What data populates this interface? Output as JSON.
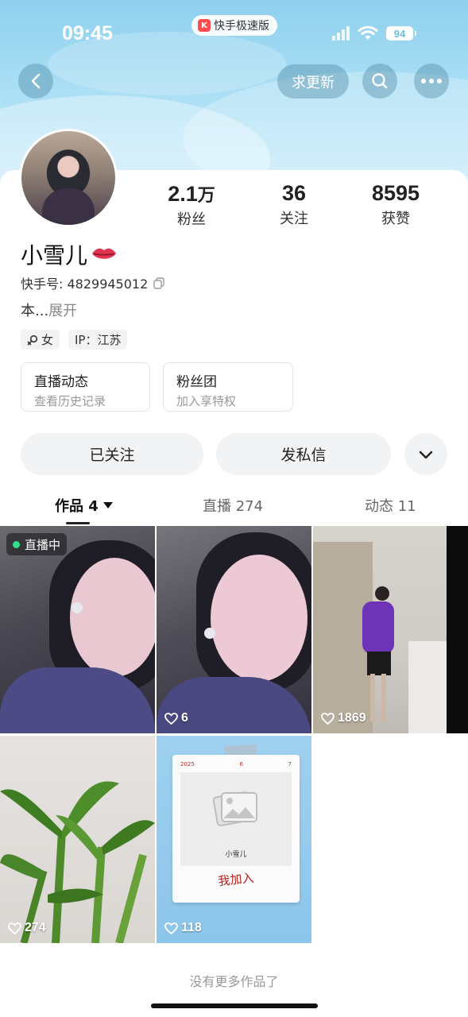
{
  "status_bar": {
    "time": "09:45",
    "app_badge": "快手极速版",
    "battery": "94"
  },
  "header": {
    "update_label": "求更新"
  },
  "profile": {
    "stats": [
      {
        "value": "2.1",
        "unit": "万",
        "label": "粉丝"
      },
      {
        "value": "36",
        "unit": "",
        "label": "关注"
      },
      {
        "value": "8595",
        "unit": "",
        "label": "获赞"
      }
    ],
    "name": "小雪儿",
    "kuaishou_id": "快手号: 4829945012",
    "bio": "本...",
    "bio_more": "展开",
    "gender_tag": "女",
    "ip_tag": "IP：江苏"
  },
  "info_boxes": [
    {
      "title": "直播动态",
      "subtitle": "查看历史记录"
    },
    {
      "title": "粉丝团",
      "subtitle": "加入享特权"
    }
  ],
  "actions": {
    "followed": "已关注",
    "message": "发私信"
  },
  "tabs": [
    {
      "label": "作品 4"
    },
    {
      "label": "直播 274"
    },
    {
      "label": "动态 11"
    }
  ],
  "posts": [
    {
      "badge": "直播中",
      "likes": ""
    },
    {
      "likes": "6"
    },
    {
      "likes": "1869"
    },
    {
      "likes": "274"
    },
    {
      "likes": "118",
      "card_date_left": "2025",
      "card_date_mid": "6",
      "card_date_right": "7",
      "card_name": "小雪儿",
      "card_handwriting": "我加入"
    }
  ],
  "footer": "没有更多作品了",
  "colors": {
    "header_sky": "#a9def4",
    "live_dot": "#2fe08a",
    "lips": "#e0334f"
  }
}
